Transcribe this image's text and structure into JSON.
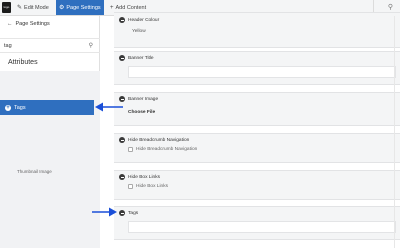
{
  "toolbar": {
    "logo_text": "logo",
    "edit_mode": "Edit Mode",
    "page_settings": "Page Settings",
    "add_content": "Add Content"
  },
  "left_panel": {
    "back_label": "Page Settings",
    "search_value": "tag",
    "section_title": "Attributes",
    "tags_item": "Tags",
    "thumbnail_label": "Thumbnail Image"
  },
  "main": {
    "header_colour": {
      "title": "Header Colour",
      "value": "Yellow"
    },
    "banner_title": {
      "title": "Banner Title",
      "value": ""
    },
    "banner_image": {
      "title": "Banner Image",
      "button": "Choose File"
    },
    "hide_breadcrumb": {
      "title": "Hide Breadcrumb Navigation",
      "checkbox_label": "Hide Breadcrumb Navigation"
    },
    "hide_box_links": {
      "title": "Hide Box Links",
      "checkbox_label": "Hide Box Links"
    },
    "tags": {
      "title": "Tags",
      "value": ""
    }
  },
  "colors": {
    "accent": "#2f6fbf",
    "annotation_arrow": "#1a4fd8"
  }
}
